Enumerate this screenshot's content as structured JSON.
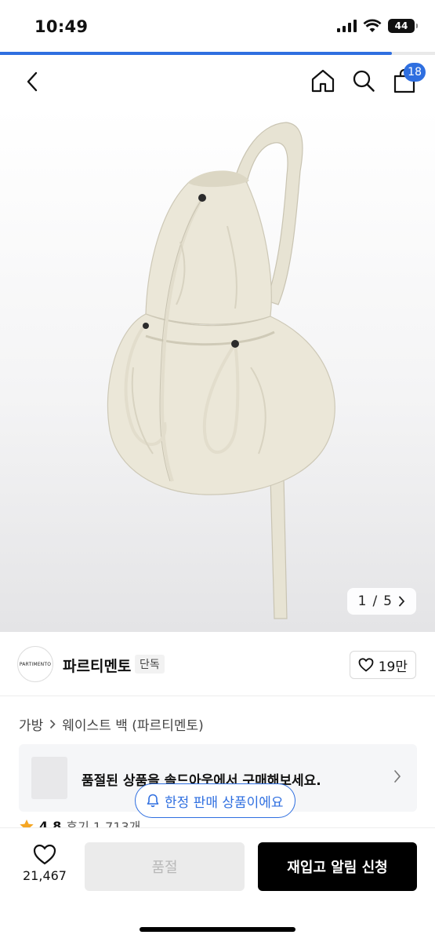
{
  "status_bar": {
    "time": "10:49",
    "battery": "44"
  },
  "page_progress": 0.9,
  "nav": {
    "cart_count": "18"
  },
  "image": {
    "counter_current": "1",
    "counter_sep": "/",
    "counter_total": "5",
    "colors": {
      "bag": "#e9e5d6",
      "background": "#f3f3f4"
    }
  },
  "brand": {
    "logo_text": "PARTIMENTO",
    "name": "파르티멘토",
    "tag": "단독",
    "like_count": "19만"
  },
  "breadcrumb": {
    "category": "가방",
    "subcategory": "웨이스트 백 (파르티멘토)"
  },
  "soldout_banner": {
    "text": "품절된 상품을 솔드아웃에서 구매해보세요."
  },
  "rating": {
    "score": "4.8",
    "reviews": "후기 1,713개"
  },
  "limited_notice": {
    "text": "한정 판매 상품이에요"
  },
  "bottom_bar": {
    "wish_count": "21,467",
    "soldout_label": "품절",
    "restock_label": "재입고 알림 신청"
  },
  "colors": {
    "accent": "#2f6fe0",
    "star": "#f5a623"
  }
}
